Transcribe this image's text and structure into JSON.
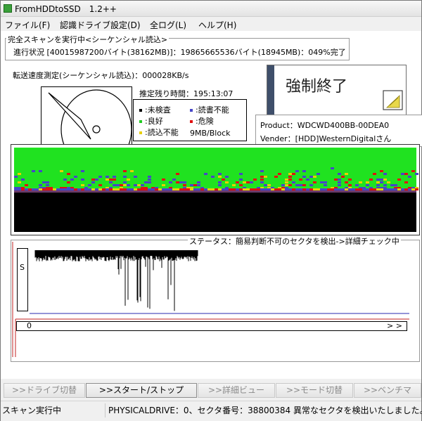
{
  "window": {
    "title": "FromHDDtoSSD　1.2++"
  },
  "menu": [
    {
      "label": "ファイル(F)"
    },
    {
      "label": "認識ドライブ設定(D)"
    },
    {
      "label": "全ログ(L)"
    },
    {
      "label": "ヘルプ(H)"
    }
  ],
  "scan": {
    "group_title": "完全スキャンを実行中<シーケンシャル読込>",
    "progress_text": "進行状況 [40015987200バイト(38162MB)]：19865665536バイト(18945MB)：049%完了",
    "speed_text": "転送速度測定(シーケンシャル読込)：000028KB/s",
    "remaining_text": "推定残り時間：195:13:07",
    "block_size": "9MB/Block"
  },
  "legend": [
    {
      "label": ":未検査",
      "color": "#000000"
    },
    {
      "label": ":読書不能",
      "color": "#4646c8"
    },
    {
      "label": ":良好",
      "color": "#22cc22"
    },
    {
      "label": ":危険",
      "color": "#e01010"
    },
    {
      "label": ":読込不能",
      "color": "#e8d000"
    }
  ],
  "abort_button": {
    "label": "強制終了"
  },
  "drive": {
    "product": "Product：WDCWD400BB-00DEA0",
    "vender": "Vender：[HDD]WesternDigitalさん"
  },
  "status": {
    "title": "ステータス：簡易判断不可のセクタを検出->詳細チェック中",
    "s_label": "S",
    "progress_start": "0",
    "progress_end": "> >"
  },
  "buttons": [
    {
      "label": ">>ドライブ切替",
      "enabled": false
    },
    {
      "label": ">>スタート/ストップ",
      "enabled": true
    },
    {
      "label": ">>詳細ビュー",
      "enabled": false
    },
    {
      "label": ">>モード切替",
      "enabled": false
    },
    {
      "label": ">>ベンチマ",
      "enabled": false
    }
  ],
  "statusbar": {
    "left": "スキャン実行中",
    "right": "PHYSICALDRIVE：0、セクタ番号：38800384 異常なセクタを検出いたしました。"
  },
  "colors": {
    "good": "#22ee22",
    "unread": "#000000",
    "danger": "#e01010",
    "rw_fail": "#4646c8",
    "read_fail": "#e8d000",
    "chrome": "#f0f0f0"
  }
}
